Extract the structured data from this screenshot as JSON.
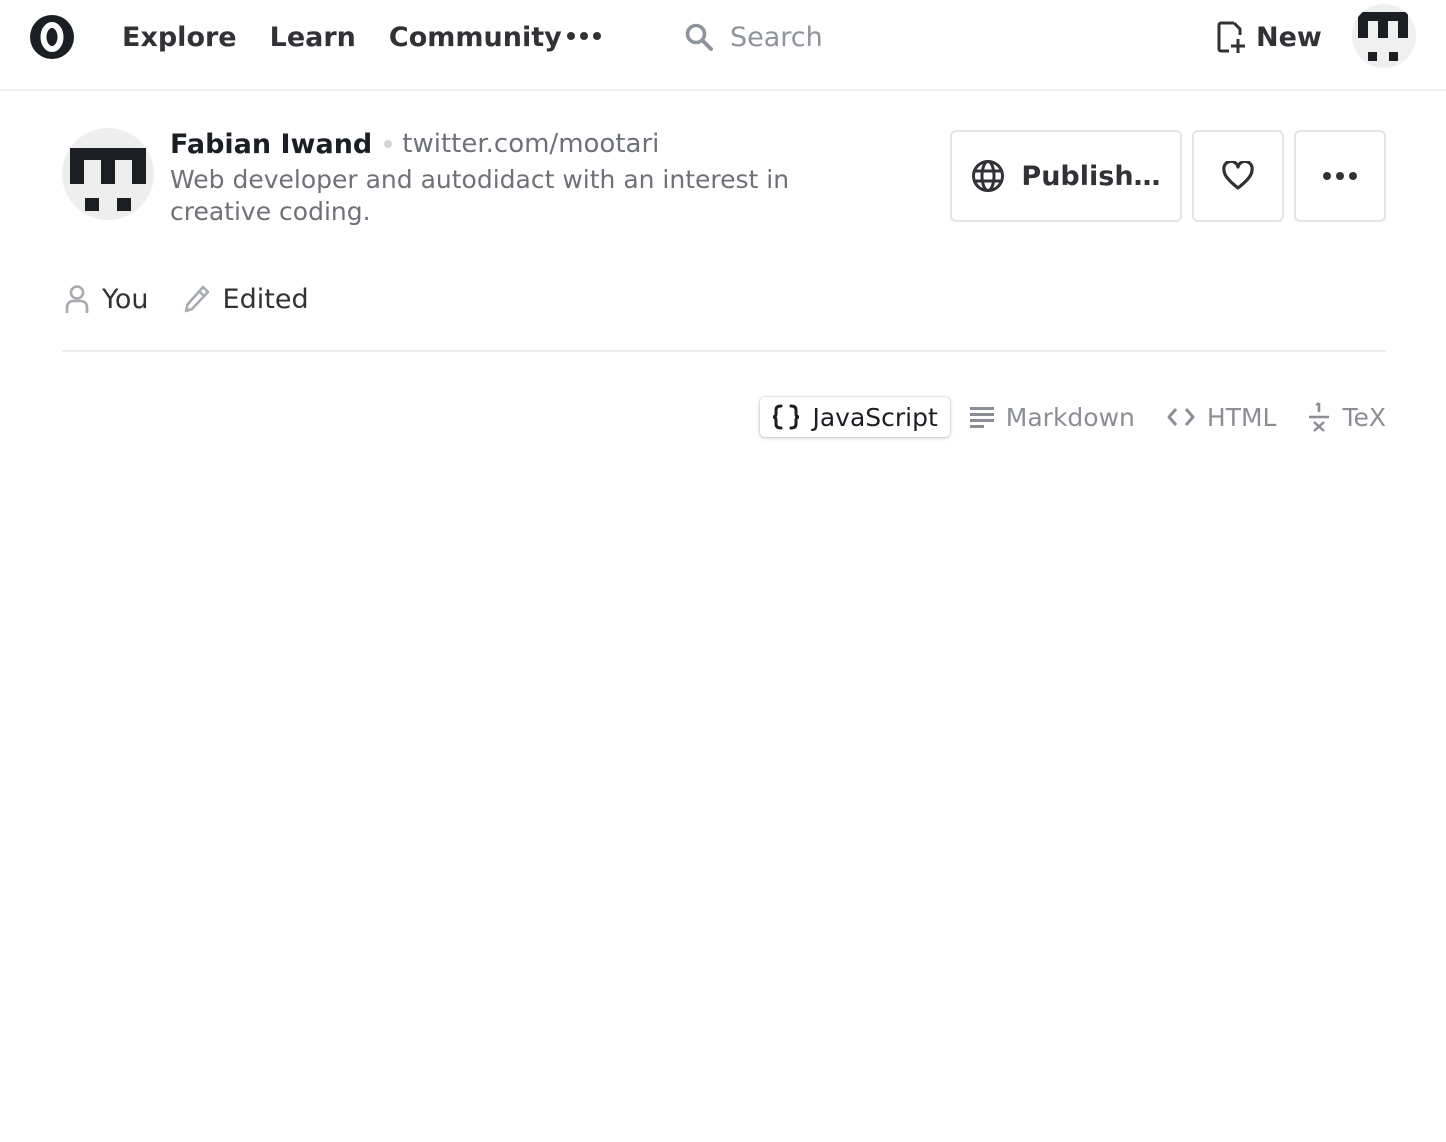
{
  "nav": {
    "links": [
      "Explore",
      "Learn",
      "Community"
    ],
    "search_placeholder": "Search",
    "new_label": "New"
  },
  "notebook": {
    "author_name": "Fabian Iwand",
    "author_link": "twitter.com/mootari",
    "author_bio": "Web developer and autodidact with an interest in creative coding.",
    "publish_label": "Publish…"
  },
  "meta": {
    "owner_label": "You",
    "status_label": "Edited"
  },
  "cell_modes": {
    "javascript": "JavaScript",
    "markdown": "Markdown",
    "html": "HTML",
    "tex": "TeX",
    "active": "JavaScript"
  },
  "icons": {
    "logo": "observable-logo-icon",
    "more": "more-horizontal-icon",
    "search": "search-icon",
    "new": "new-notebook-icon",
    "publish": "globe-icon",
    "like": "heart-icon",
    "owner": "user-icon",
    "status": "pencil-icon"
  },
  "colors": {
    "text_primary": "#1b1e23",
    "text_secondary": "#6e7177",
    "icon_gray": "#8f939b",
    "border": "#e4e4e4"
  }
}
